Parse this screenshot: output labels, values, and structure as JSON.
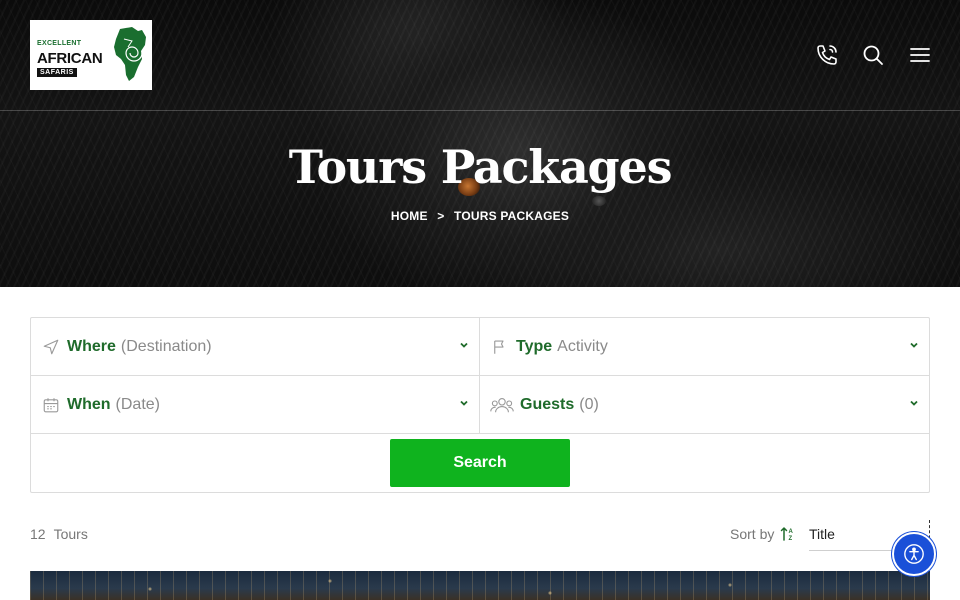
{
  "header": {
    "logo": {
      "line1": "EXCELLENT",
      "line2": "AFRICAN",
      "line3": "SAFARIS",
      "brand_color": "#1a6e2f"
    },
    "icons": [
      "phone-icon",
      "search-icon",
      "menu-icon"
    ]
  },
  "hero": {
    "title": "Tours Packages",
    "breadcrumb": {
      "home": "HOME",
      "separator": ">",
      "current": "TOURS PACKAGES"
    }
  },
  "search_form": {
    "where": {
      "label": "Where",
      "placeholder": "(Destination)",
      "icon": "navigation-arrow-icon"
    },
    "type": {
      "label": "Type",
      "placeholder": "Activity",
      "icon": "flag-icon"
    },
    "when": {
      "label": "When",
      "placeholder": "(Date)",
      "icon": "calendar-icon"
    },
    "guests": {
      "label": "Guests",
      "placeholder": "(0)",
      "icon": "group-icon"
    },
    "submit_label": "Search",
    "label_color": "#1f6b2b",
    "button_color": "#0fb31e"
  },
  "results": {
    "count": "12",
    "count_label": "Tours",
    "sort_label": "Sort by",
    "sort_value": "Title"
  },
  "accessibility_color": "#1a50d8"
}
